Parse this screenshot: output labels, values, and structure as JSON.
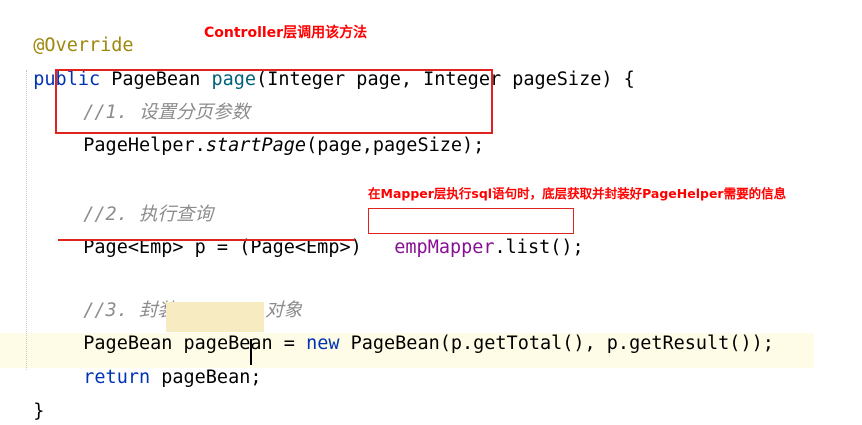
{
  "annotations": {
    "controller_note": "Controller层调用该方法",
    "mapper_note": "在Mapper层执行sql语句时，底层获取并封装好PageHelper需要的信息"
  },
  "code": {
    "annotation": "@Override",
    "sig_public": "public",
    "sig_type": " PageBean ",
    "sig_method": "page",
    "sig_params": "(Integer page, Integer pageSize) {",
    "comment1": "//1. 设置分页参数",
    "ph_class": "PageHelper.",
    "ph_method": "startPage",
    "ph_args": "(page,pageSize);",
    "comment2": "//2. 执行查询",
    "page_decl": "Page<Emp> p = (Page<Emp>)",
    "mapper_field": "empMapper",
    "mapper_call": ".list();",
    "comment3": "//3. 封装PageBean对象",
    "pb_type": "PageBean ",
    "pb_var": "pageBean",
    "pb_assign": " = ",
    "pb_new": "new",
    "pb_ctor": " PageBean(p.getTotal(), p.getResult());",
    "ret_kw": "return",
    "ret_val": " pageBean;",
    "close_brace": "}"
  }
}
